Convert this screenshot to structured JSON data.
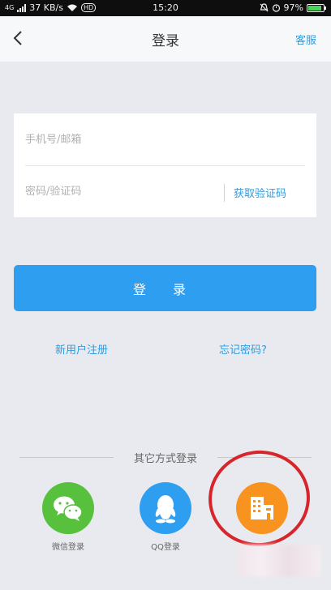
{
  "status_bar": {
    "left_text": "4G",
    "speed": "37 KB/s",
    "hd": "HD",
    "time": "15:20",
    "battery": "97%"
  },
  "nav": {
    "title": "登录",
    "right_link": "客服"
  },
  "form": {
    "phone_placeholder": "手机号/邮箱",
    "code_placeholder": "密码/验证码",
    "get_code_label": "获取验证码"
  },
  "login_button": "登 录",
  "links": {
    "register": "新用户注册",
    "forgot": "忘记密码?"
  },
  "other_login": {
    "title": "其它方式登录",
    "items": [
      {
        "label": "微信登录",
        "icon": "wechat-icon",
        "color": "#57c03c"
      },
      {
        "label": "QQ登录",
        "icon": "qq-icon",
        "color": "#2e9ff0"
      },
      {
        "label": "",
        "icon": "company-icon",
        "color": "#f7931e"
      }
    ]
  },
  "colors": {
    "accent": "#2e9ff0",
    "background": "#e8eaef",
    "annotation": "#d6262b"
  }
}
